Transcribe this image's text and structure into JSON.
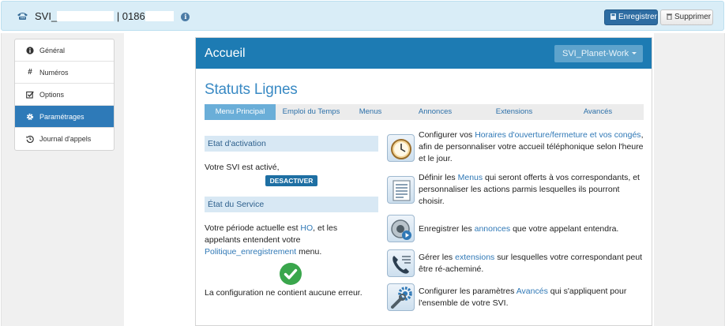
{
  "header": {
    "title_prefix": "SVI_",
    "separator": "| 0186",
    "save_label": "Enregistrer",
    "delete_label": "Supprimer"
  },
  "sidebar": {
    "items": [
      {
        "label": "Général",
        "icon": "info-circle-icon",
        "active": false
      },
      {
        "label": "Numéros",
        "icon": "hash-icon",
        "active": false
      },
      {
        "label": "Options",
        "icon": "checkbox-icon",
        "active": false
      },
      {
        "label": "Paramétrages",
        "icon": "gear-icon",
        "active": true
      },
      {
        "label": "Journal d'appels",
        "icon": "history-icon",
        "active": false
      }
    ]
  },
  "card": {
    "title": "Accueil",
    "dropdown_value": "SVI_Planet-Work",
    "heading": "Statuts Lignes"
  },
  "tabs": [
    {
      "label": "Menu Principal",
      "active": true
    },
    {
      "label": "Emploi du Temps",
      "active": false
    },
    {
      "label": "Menus",
      "active": false
    },
    {
      "label": "Annonces",
      "active": false
    },
    {
      "label": "Extensions",
      "active": false
    },
    {
      "label": "Avancés",
      "active": false
    }
  ],
  "activation": {
    "title": "Etat d'activation",
    "status_text": "Votre SVI est activé,",
    "button_label": "DESACTIVER"
  },
  "service": {
    "title": "État du Service",
    "line1_a": "Votre période actuelle est ",
    "line1_link": "HO",
    "line1_b": ", et les",
    "line2": "appelants entendent votre",
    "line3_link": "Politique_enregistrement",
    "line3_b": " menu.",
    "config_text": "La configuration ne contient aucune erreur."
  },
  "features": [
    {
      "icon": "clock-icon",
      "a": "Configurer vos ",
      "link": "Horaires d'ouverture/fermeture et vos congés",
      "b": ", afin de personnaliser votre accueil téléphonique selon l'heure et le jour."
    },
    {
      "icon": "menu-list-icon",
      "a": "Définir les ",
      "link": "Menus",
      "b": " qui seront offerts à vos correspondants, et personnaliser les actions parmis lesquelles ils pourront choisir."
    },
    {
      "icon": "audio-icon",
      "a": "Enregistrer les ",
      "link": "annonces",
      "b": " que votre appelant entendra."
    },
    {
      "icon": "phone-directory-icon",
      "a": "Gérer les ",
      "link": "extensions",
      "b": " sur lesquelles votre correspondant peut être ré-acheminé."
    },
    {
      "icon": "wrench-gear-icon",
      "a": "Configurer les paramètres ",
      "link": "Avancés",
      "b": " qui s'appliquent pour l'ensemble de votre SVI."
    }
  ]
}
